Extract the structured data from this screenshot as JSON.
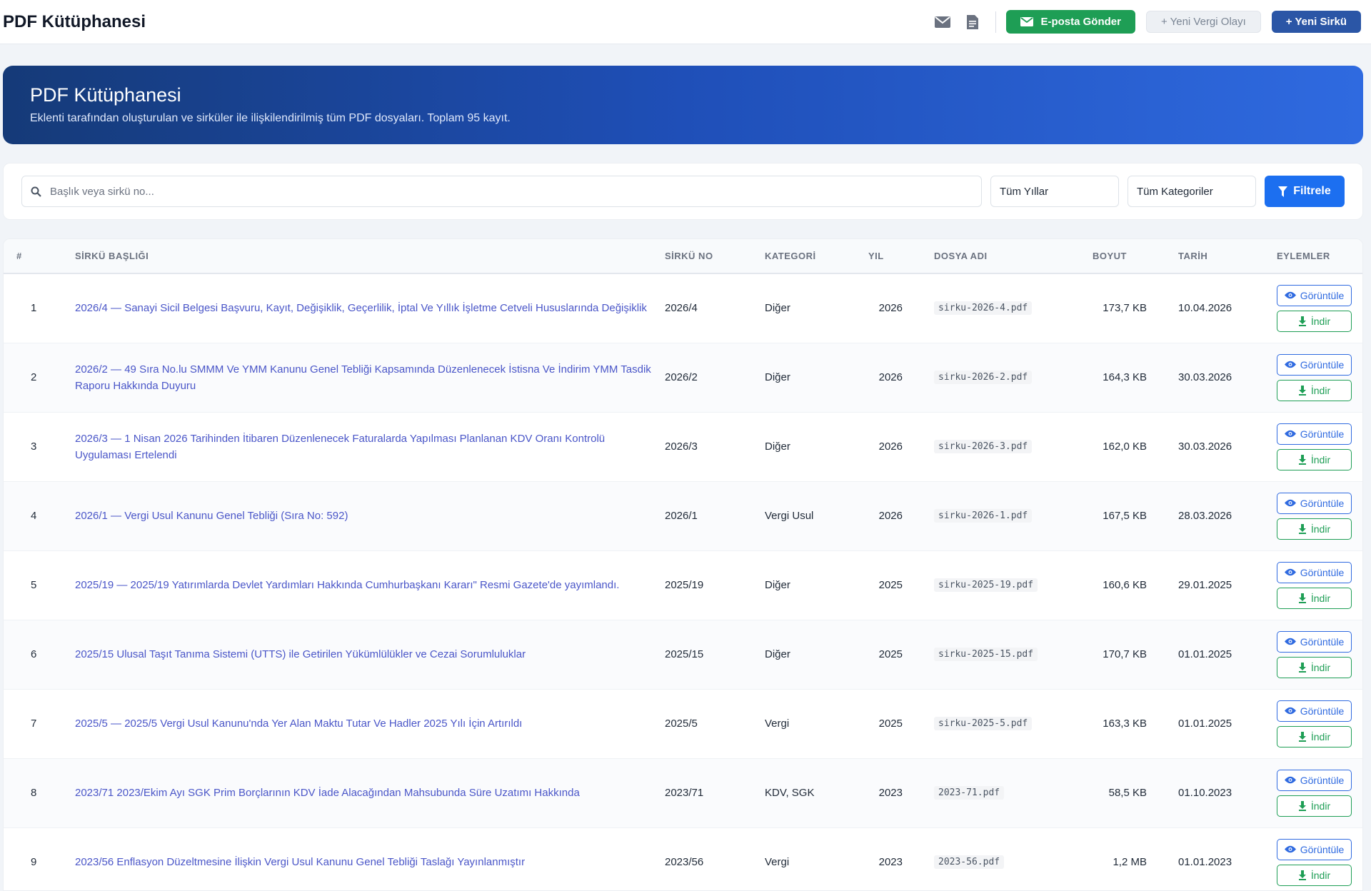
{
  "header": {
    "title": "PDF Kütüphanesi",
    "email_button": "E-posta Gönder",
    "new_tax_event_button": "+ Yeni Vergi Olayı",
    "new_circular_button": "+ Yeni Sirkü"
  },
  "hero": {
    "title": "PDF Kütüphanesi",
    "subtitle": "Eklenti tarafından oluşturulan ve sirküler ile ilişkilendirilmiş tüm PDF dosyaları. Toplam 95 kayıt."
  },
  "filters": {
    "search_placeholder": "Başlık veya sirkü no...",
    "year_select": "Tüm Yıllar",
    "category_select": "Tüm Kategoriler",
    "filter_button": "Filtrele"
  },
  "table": {
    "columns": {
      "num": "#",
      "title": "SİRKÜ BAŞLIĞI",
      "no": "SİRKÜ NO",
      "category": "KATEGORİ",
      "year": "YIL",
      "file": "DOSYA ADI",
      "size": "BOYUT",
      "date": "TARİH",
      "actions": "EYLEMLER"
    },
    "view_label": "Görüntüle",
    "download_label": "İndir",
    "rows": [
      {
        "num": "1",
        "title": "2026/4 — Sanayi Sicil Belgesi Başvuru, Kayıt, Değişiklik, Geçerlilik, İptal Ve Yıllık İşletme Cetveli Hususlarında Değişiklik",
        "no": "2026/4",
        "category": "Diğer",
        "year": "2026",
        "file": "sirku-2026-4.pdf",
        "size": "173,7 KB",
        "date": "10.04.2026"
      },
      {
        "num": "2",
        "title": "2026/2 — 49 Sıra No.lu SMMM Ve YMM Kanunu Genel Tebliği Kapsamında Düzenlenecek İstisna Ve İndirim YMM Tasdik Raporu Hakkında Duyuru",
        "no": "2026/2",
        "category": "Diğer",
        "year": "2026",
        "file": "sirku-2026-2.pdf",
        "size": "164,3 KB",
        "date": "30.03.2026"
      },
      {
        "num": "3",
        "title": "2026/3 — 1 Nisan 2026 Tarihinden İtibaren Düzenlenecek Faturalarda Yapılması Planlanan KDV Oranı Kontrolü Uygulaması Ertelendi",
        "no": "2026/3",
        "category": "Diğer",
        "year": "2026",
        "file": "sirku-2026-3.pdf",
        "size": "162,0 KB",
        "date": "30.03.2026"
      },
      {
        "num": "4",
        "title": "2026/1 — Vergi Usul Kanunu Genel Tebliği (Sıra No: 592)",
        "no": "2026/1",
        "category": "Vergi Usul",
        "year": "2026",
        "file": "sirku-2026-1.pdf",
        "size": "167,5 KB",
        "date": "28.03.2026"
      },
      {
        "num": "5",
        "title": "2025/19 — 2025/19 Yatırımlarda Devlet Yardımları Hakkında Cumhurbaşkanı Kararı\" Resmi Gazete'de yayımlandı.",
        "no": "2025/19",
        "category": "Diğer",
        "year": "2025",
        "file": "sirku-2025-19.pdf",
        "size": "160,6 KB",
        "date": "29.01.2025"
      },
      {
        "num": "6",
        "title": "2025/15 Ulusal Taşıt Tanıma Sistemi (UTTS) ile Getirilen Yükümlülükler ve Cezai Sorumluluklar",
        "no": "2025/15",
        "category": "Diğer",
        "year": "2025",
        "file": "sirku-2025-15.pdf",
        "size": "170,7 KB",
        "date": "01.01.2025"
      },
      {
        "num": "7",
        "title": "2025/5 — 2025/5 Vergi Usul Kanunu'nda Yer Alan Maktu Tutar Ve Hadler 2025 Yılı İçin Artırıldı",
        "no": "2025/5",
        "category": "Vergi",
        "year": "2025",
        "file": "sirku-2025-5.pdf",
        "size": "163,3 KB",
        "date": "01.01.2025"
      },
      {
        "num": "8",
        "title": "2023/71 2023/Ekim Ayı SGK Prim Borçlarının KDV İade Alacağından Mahsubunda Süre Uzatımı Hakkında",
        "no": "2023/71",
        "category": "KDV, SGK",
        "year": "2023",
        "file": "2023-71.pdf",
        "size": "58,5 KB",
        "date": "01.10.2023"
      },
      {
        "num": "9",
        "title": "2023/56 Enflasyon Düzeltmesine İlişkin Vergi Usul Kanunu Genel Tebliği Taslağı Yayınlanmıştır",
        "no": "2023/56",
        "category": "Vergi",
        "year": "2023",
        "file": "2023-56.pdf",
        "size": "1,2 MB",
        "date": "01.01.2023"
      }
    ]
  },
  "colors": {
    "accent": "#1c6ff0",
    "success": "#1e9e55",
    "hero_start": "#153a78",
    "hero_end": "#2f6ae0",
    "link": "#4a56c8"
  },
  "icons": {
    "mail": "mail-icon",
    "document": "document-icon",
    "search": "search-icon",
    "filter": "filter-icon",
    "eye": "eye-icon",
    "download": "download-icon"
  }
}
